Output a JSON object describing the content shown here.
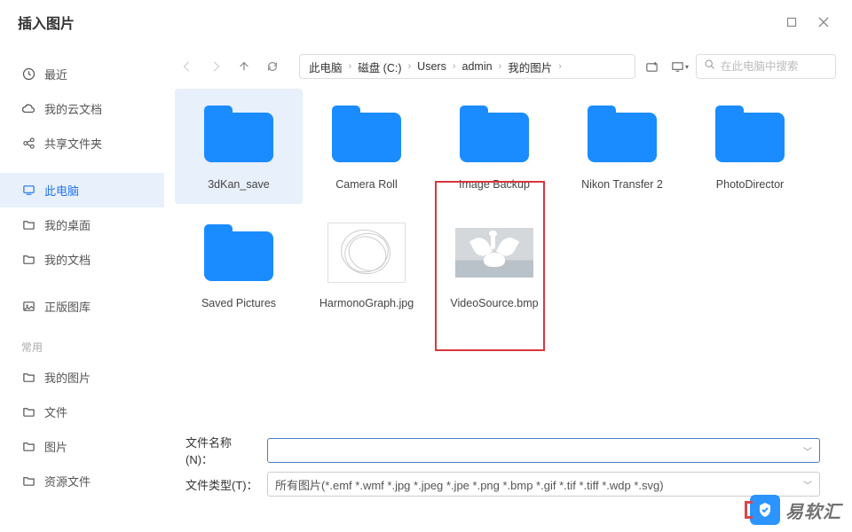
{
  "window": {
    "title": "插入图片"
  },
  "sidebar": {
    "items": [
      {
        "icon": "clock-icon",
        "label": "最近"
      },
      {
        "icon": "cloud-icon",
        "label": "我的云文档"
      },
      {
        "icon": "share-icon",
        "label": "共享文件夹"
      },
      {
        "icon": "monitor-icon",
        "label": "此电脑",
        "active": true
      },
      {
        "icon": "folder-icon",
        "label": "我的桌面"
      },
      {
        "icon": "folder-icon",
        "label": "我的文档"
      },
      {
        "icon": "gallery-icon",
        "label": "正版图库"
      }
    ],
    "section_label": "常用",
    "common": [
      {
        "icon": "folder-icon",
        "label": "我的图片"
      },
      {
        "icon": "folder-icon",
        "label": "文件"
      },
      {
        "icon": "folder-icon",
        "label": "图片"
      },
      {
        "icon": "folder-icon",
        "label": "资源文件"
      }
    ]
  },
  "breadcrumb": [
    "此电脑",
    "磁盘 (C:)",
    "Users",
    "admin",
    "我的图片"
  ],
  "search": {
    "placeholder": "在此电脑中搜索"
  },
  "files": [
    {
      "name": "3dKan_save",
      "type": "folder",
      "selected": true
    },
    {
      "name": "Camera Roll",
      "type": "folder"
    },
    {
      "name": "Image Backup",
      "type": "folder"
    },
    {
      "name": "Nikon Transfer 2",
      "type": "folder"
    },
    {
      "name": "PhotoDirector",
      "type": "folder"
    },
    {
      "name": "Saved Pictures",
      "type": "folder"
    },
    {
      "name": "HarmonoGraph.jpg",
      "type": "image-swirl"
    },
    {
      "name": "VideoSource.bmp",
      "type": "image-swan"
    }
  ],
  "bottom": {
    "name_label": "文件名称(N)：",
    "name_value": "",
    "type_label": "文件类型(T)：",
    "type_value": "所有图片(*.emf *.wmf *.jpg *.jpeg *.jpe *.png *.bmp *.gif *.tif *.tiff *.wdp *.svg)"
  },
  "watermark": "易软汇"
}
